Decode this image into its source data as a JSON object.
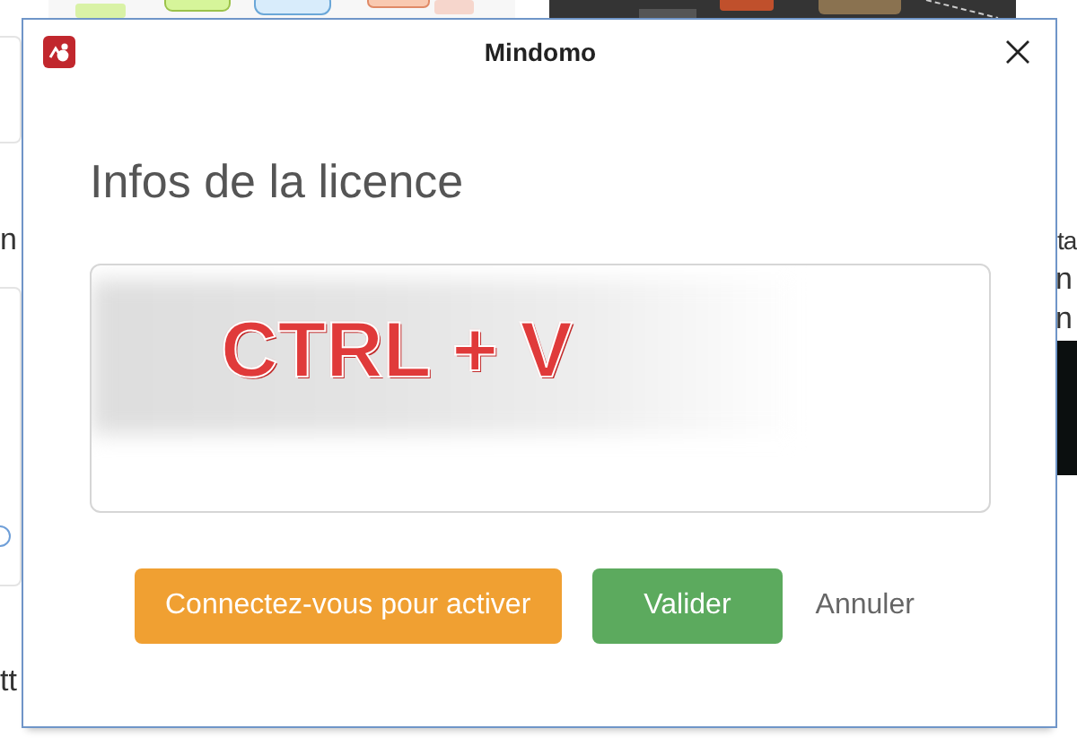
{
  "background": {
    "left_texts": [
      "n",
      "tt"
    ],
    "right_texts": [
      "ta",
      "n",
      "n"
    ],
    "radio": {
      "selected": false
    }
  },
  "dialog": {
    "title": "Mindomo",
    "heading": "Infos de la licence",
    "license_field": {
      "annotation": "CTRL + V"
    },
    "buttons": [
      {
        "label": "Connectez-vous pour activer",
        "kind": "warning"
      },
      {
        "label": "Valider",
        "kind": "success"
      },
      {
        "label": "Annuler",
        "kind": "link"
      }
    ]
  }
}
